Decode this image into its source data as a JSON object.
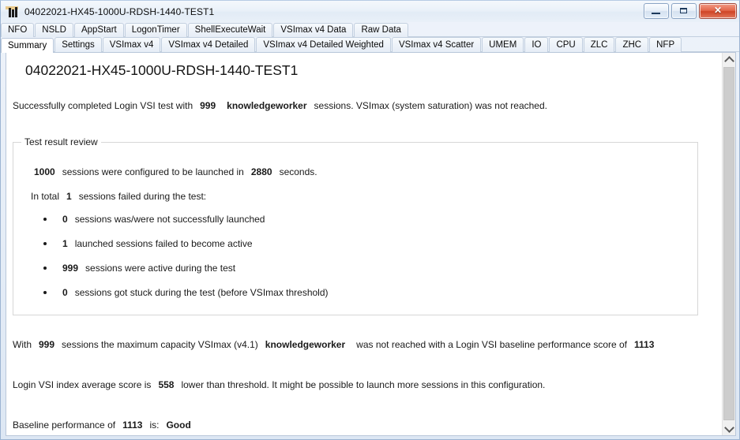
{
  "window": {
    "title": "04022021-HX45-1000U-RDSH-1440-TEST1",
    "icon": "bar-chart-icon",
    "minimize_label": "",
    "maximize_label": "",
    "close_label": "✕"
  },
  "tabs_row1": [
    {
      "label": "NFO",
      "active": false
    },
    {
      "label": "NSLD",
      "active": false
    },
    {
      "label": "AppStart",
      "active": false
    },
    {
      "label": "LogonTimer",
      "active": false
    },
    {
      "label": "ShellExecuteWait",
      "active": false
    },
    {
      "label": "VSImax v4 Data",
      "active": false
    },
    {
      "label": "Raw Data",
      "active": false
    }
  ],
  "tabs_row2": [
    {
      "label": "Summary",
      "active": true
    },
    {
      "label": "Settings",
      "active": false
    },
    {
      "label": "VSImax v4",
      "active": false
    },
    {
      "label": "VSImax v4 Detailed",
      "active": false
    },
    {
      "label": "VSImax v4 Detailed Weighted",
      "active": false
    },
    {
      "label": "VSImax v4 Scatter",
      "active": false
    },
    {
      "label": "UMEM",
      "active": false
    },
    {
      "label": "IO",
      "active": false
    },
    {
      "label": "CPU",
      "active": false
    },
    {
      "label": "ZLC",
      "active": false
    },
    {
      "label": "ZHC",
      "active": false
    },
    {
      "label": "NFP",
      "active": false
    }
  ],
  "report": {
    "title": "04022021-HX45-1000U-RDSH-1440-TEST1",
    "intro": {
      "prefix": "Successfully completed Login VSI test with",
      "sessions": "999",
      "workload": "knowledgeworker",
      "suffix": "sessions. VSImax (system saturation) was not reached."
    },
    "groupbox": {
      "title": "Test result review",
      "configured": {
        "count": "1000",
        "mid": "sessions were configured to be launched in",
        "seconds": "2880",
        "suffix": "seconds."
      },
      "failed": {
        "prefix": "In total",
        "count": "1",
        "suffix": "sessions failed during the test:"
      },
      "bullets": [
        {
          "value": "0",
          "text": "sessions was/were not successfully launched"
        },
        {
          "value": "1",
          "text": "launched sessions failed to become active"
        },
        {
          "value": "999",
          "text": "sessions were active during the test"
        },
        {
          "value": "0",
          "text": "sessions got stuck during the test (before VSImax threshold)"
        }
      ]
    },
    "capacity": {
      "prefix": "With",
      "sessions": "999",
      "mid": "sessions the maximum capacity VSImax (v4.1)",
      "workload": "knowledgeworker",
      "suffix": "was not reached with a Login VSI baseline performance score of",
      "baseline": "1113"
    },
    "index": {
      "prefix": "Login VSI index average score is",
      "value": "558",
      "suffix": "lower than threshold. It might be possible to launch more sessions in this configuration."
    },
    "baseline_perf": {
      "prefix": "Baseline performance of",
      "value": "1113",
      "mid": "is:",
      "rating": "Good"
    }
  },
  "scrollbar": {
    "up_arrow": "scroll-up-arrow",
    "down_arrow": "scroll-down-arrow"
  }
}
